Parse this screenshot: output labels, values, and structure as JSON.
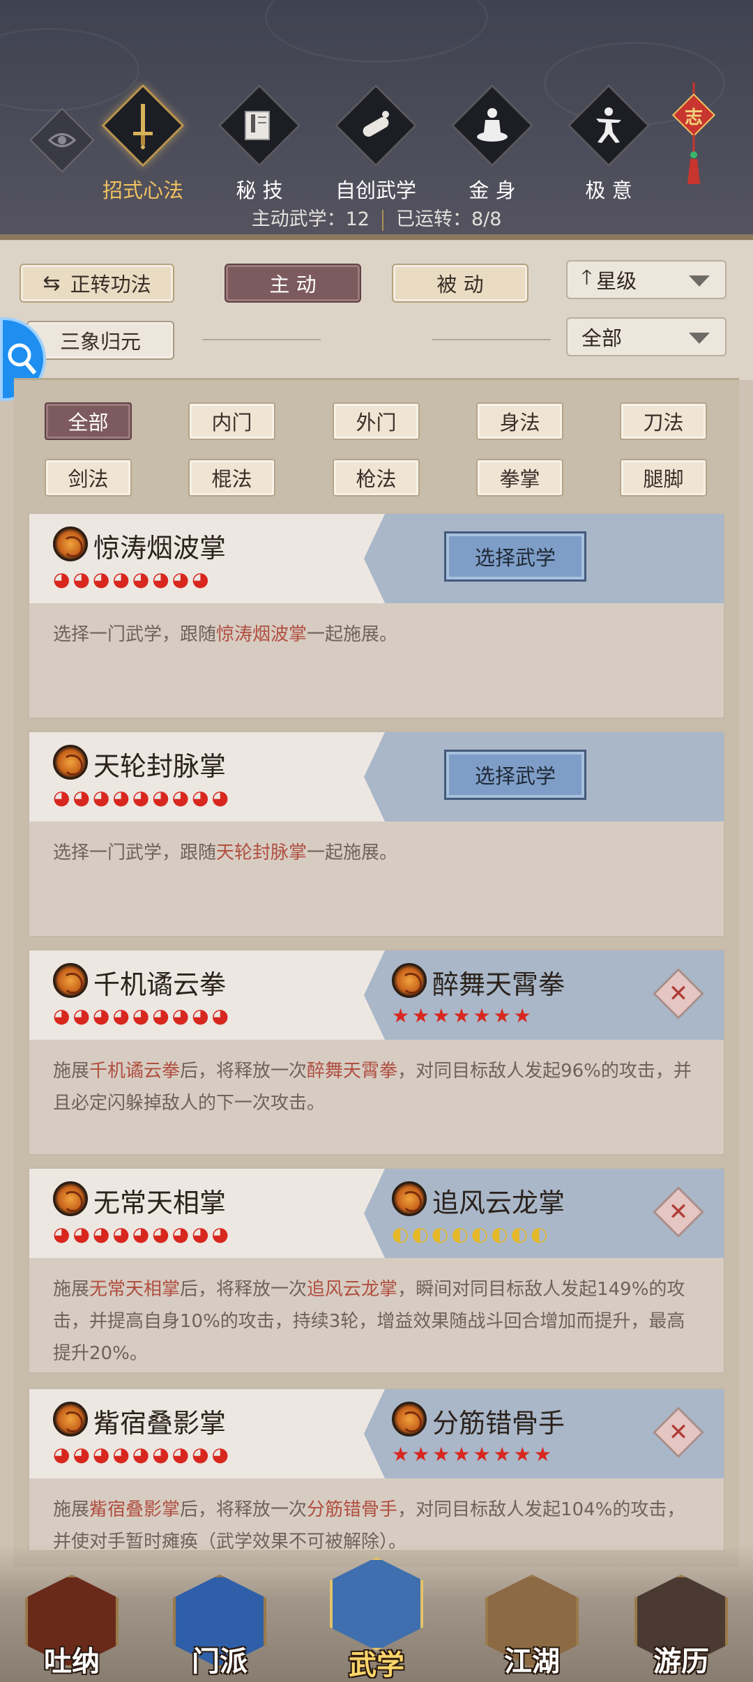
{
  "top_tabs": [
    {
      "label": "招式心法",
      "icon": "sword-icon",
      "active": true
    },
    {
      "label": "秘 技",
      "icon": "book-icon",
      "active": false
    },
    {
      "label": "自创武学",
      "icon": "scroll-icon",
      "active": false
    },
    {
      "label": "金 身",
      "icon": "meditation-icon",
      "active": false
    },
    {
      "label": "极 意",
      "icon": "martial-stance-icon",
      "active": false
    }
  ],
  "knot_label": "志",
  "stats": {
    "active_label": "主动武学：12",
    "running_label": "已运转：8/8"
  },
  "controls": {
    "switch_label": "正转功法",
    "active_label": "主 动",
    "passive_label": "被 动",
    "sort_label": "星级",
    "preset_label": "三象归元",
    "filter_label": "全部"
  },
  "categories": [
    "全部",
    "内门",
    "外门",
    "身法",
    "刀法",
    "剑法",
    "棍法",
    "枪法",
    "拳掌",
    "腿脚"
  ],
  "cards": [
    {
      "name": "惊涛烟波掌",
      "stars": 8,
      "select_label": "选择武学",
      "desc": {
        "pre": "选择一门武学，跟随",
        "h1": "惊涛烟波掌",
        "mid": "一起施展。",
        "h2": "",
        "post": ""
      }
    },
    {
      "name": "天轮封脉掌",
      "stars": 9,
      "select_label": "选择武学",
      "desc": {
        "pre": "选择一门武学，跟随",
        "h1": "天轮封脉掌",
        "mid": "一起施展。",
        "h2": "",
        "post": ""
      }
    },
    {
      "name": "千机谲云拳",
      "stars": 9,
      "partner": "醉舞天霄拳",
      "partner_stars": 7,
      "desc": {
        "pre": "施展",
        "h1": "千机谲云拳",
        "mid": "后，将释放一次",
        "h2": "醉舞天霄拳",
        "post": "，对同目标敌人发起96%的攻击，并且必定闪躲掉敌人的下一次攻击。"
      }
    },
    {
      "name": "无常天相掌",
      "stars": 9,
      "partner": "追风云龙掌",
      "partner_stars": 8,
      "desc": {
        "pre": "施展",
        "h1": "无常天相掌",
        "mid": "后，将释放一次",
        "h2": "追风云龙掌",
        "post": "，瞬间对同目标敌人发起149%的攻击，并提高自身10%的攻击，持续3轮，增益效果随战斗回合增加而提升，最高提升20%。"
      }
    },
    {
      "name": "觜宿叠影掌",
      "stars": 9,
      "partner": "分筋错骨手",
      "partner_stars": 8,
      "desc": {
        "pre": "施展",
        "h1": "觜宿叠影掌",
        "mid": "后，将释放一次",
        "h2": "分筋错骨手",
        "post": "，对同目标敌人发起104%的攻击，并使对手暂时瘫痪（武学效果不可被解除）。"
      }
    }
  ],
  "bottom_nav": [
    {
      "label": "吐纳",
      "active": false
    },
    {
      "label": "门派",
      "active": false
    },
    {
      "label": "武学",
      "active": true
    },
    {
      "label": "江湖",
      "active": false
    },
    {
      "label": "游历",
      "active": false
    }
  ],
  "colors": {
    "accent_gold": "#f0c260",
    "tab_dark": "#7d5a5d",
    "select_blue": "#7e9ec7",
    "highlight_red": "#b04f40"
  }
}
